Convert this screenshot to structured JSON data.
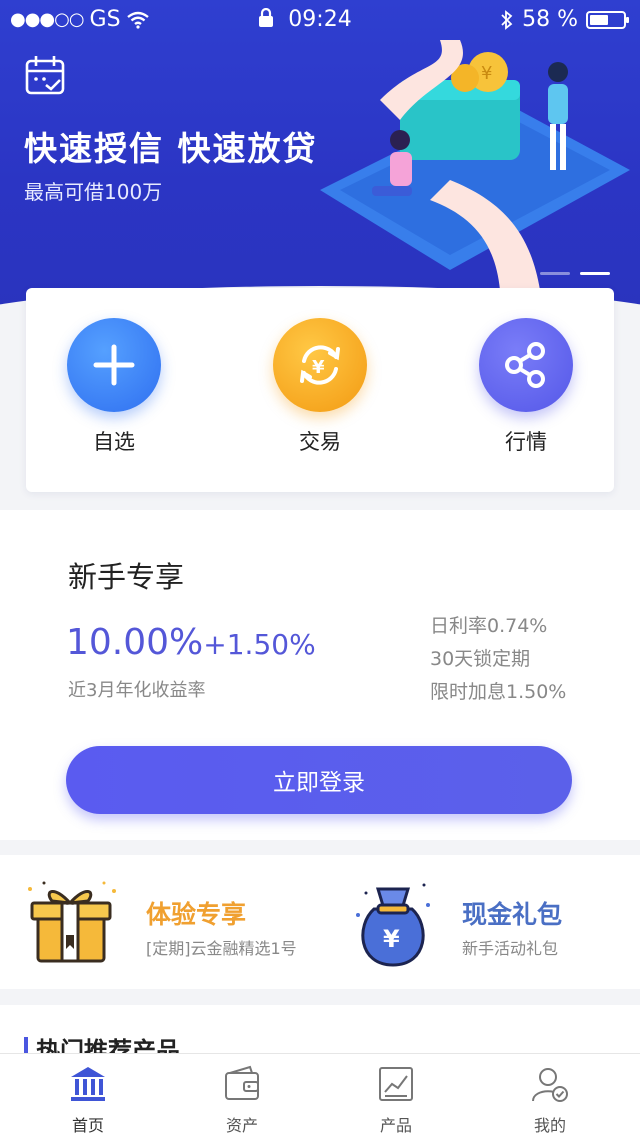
{
  "status_bar": {
    "carrier": "GS",
    "time": "09:24",
    "battery": "58 %"
  },
  "banner": {
    "title": "快速授信 快速放贷",
    "subtitle": "最高可借100万",
    "page_count": 2,
    "active_page": 2
  },
  "quick_nav": [
    {
      "label": "自选",
      "icon": "plus-icon",
      "color": "#3b82f6"
    },
    {
      "label": "交易",
      "icon": "yuan-exchange-icon",
      "color": "#f5a623"
    },
    {
      "label": "行情",
      "icon": "share-icon",
      "color": "#5b5ff0"
    }
  ],
  "newcomer": {
    "title": "新手专享",
    "rate_main": "10.00%",
    "rate_bonus": "+1.50%",
    "rate_desc": "近3月年化收益率",
    "details": [
      "日利率0.74%",
      "30天锁定期",
      "限时加息1.50%"
    ],
    "login_label": "立即登录"
  },
  "promos": [
    {
      "title": "体验专享",
      "subtitle": "[定期]云金融精选1号",
      "icon": "gift-box-icon",
      "color": "#f0a030"
    },
    {
      "title": "现金礼包",
      "subtitle": "新手活动礼包",
      "icon": "money-bag-icon",
      "color": "#4a6fc4"
    }
  ],
  "hot_section": {
    "title": "热门推荐产品"
  },
  "tabbar": [
    {
      "label": "首页",
      "icon": "home-bank-icon",
      "active": true
    },
    {
      "label": "资产",
      "icon": "wallet-icon",
      "active": false
    },
    {
      "label": "产品",
      "icon": "chart-icon",
      "active": false
    },
    {
      "label": "我的",
      "icon": "user-icon",
      "active": false
    }
  ],
  "colors": {
    "brand": "#2f3fd0",
    "accent": "#5a5bf0",
    "orange": "#f0a030"
  }
}
